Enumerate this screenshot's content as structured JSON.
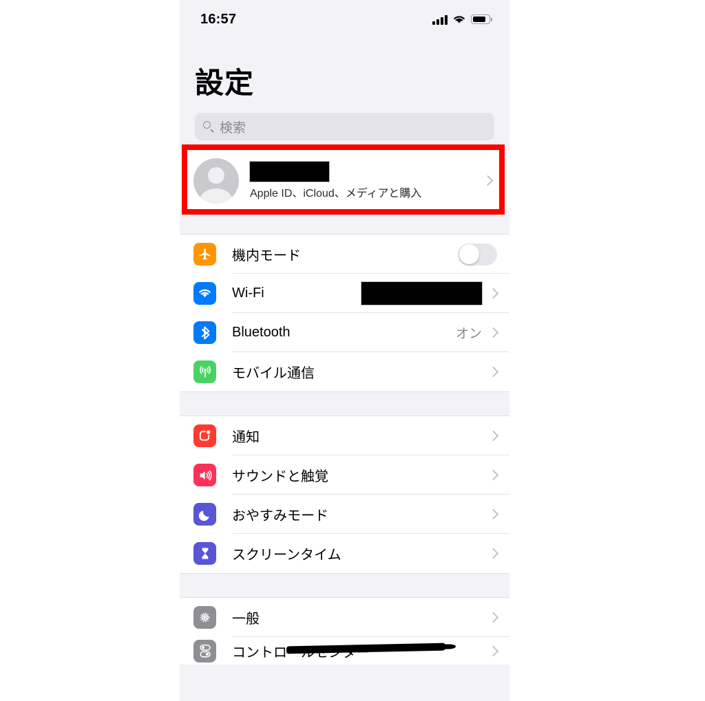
{
  "status_bar": {
    "time": "16:57",
    "signal_icon": "cellular-signal-icon",
    "wifi_icon": "wifi-icon",
    "battery_icon": "battery-icon"
  },
  "header": {
    "title": "設定"
  },
  "search": {
    "placeholder": "検索",
    "value": "",
    "icon": "search-icon"
  },
  "account": {
    "name": "",
    "name_redacted": true,
    "subtitle": "Apple ID、iCloud、メディアと購入",
    "avatar_icon": "person-avatar-icon",
    "chevron_icon": "chevron-right-icon",
    "highlighted": true,
    "highlight_color": "#ff0000"
  },
  "groups": [
    {
      "rows": [
        {
          "label": "機内モード",
          "icon": "airplane-icon",
          "icon_color": "#ff9500",
          "control": "toggle",
          "toggle_on": false
        },
        {
          "label": "Wi-Fi",
          "icon": "wifi-icon",
          "icon_color": "#007aff",
          "control": "chevron",
          "value": "",
          "value_redacted": true
        },
        {
          "label": "Bluetooth",
          "icon": "bluetooth-icon",
          "icon_color": "#007aff",
          "control": "chevron",
          "value": "オン"
        },
        {
          "label": "モバイル通信",
          "icon": "cellular-icon",
          "icon_color": "#34c759",
          "control": "chevron",
          "value": ""
        }
      ]
    },
    {
      "rows": [
        {
          "label": "通知",
          "icon": "notification-icon",
          "icon_color": "#ff3b30",
          "control": "chevron",
          "value": ""
        },
        {
          "label": "サウンドと触覚",
          "icon": "sound-haptics-icon",
          "icon_color": "#fc3158",
          "control": "chevron",
          "value": ""
        },
        {
          "label": "おやすみモード",
          "icon": "moon-icon",
          "icon_color": "#5856d6",
          "control": "chevron",
          "value": ""
        },
        {
          "label": "スクリーンタイム",
          "icon": "hourglass-icon",
          "icon_color": "#5856d6",
          "control": "chevron",
          "value": ""
        }
      ]
    },
    {
      "rows": [
        {
          "label": "一般",
          "icon": "gear-icon",
          "icon_color": "#8e8e93",
          "control": "chevron",
          "value": ""
        },
        {
          "label": "コントロールセンター",
          "icon": "control-center-icon",
          "icon_color": "#8e8e93",
          "control": "chevron",
          "value": "",
          "marker_struck": true
        }
      ]
    }
  ]
}
